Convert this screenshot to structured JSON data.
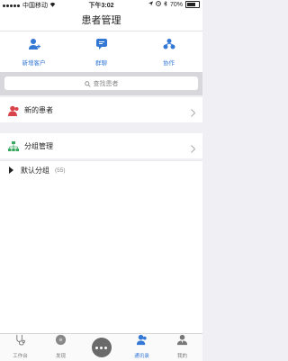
{
  "status_bar": {
    "carrier": "中国移动",
    "time": "下午3:02",
    "battery": "70%"
  },
  "navbar": {
    "title": "患者管理"
  },
  "actions": [
    {
      "label": "新增客户",
      "icon": "add-user-icon"
    },
    {
      "label": "群聊",
      "icon": "chat-icon"
    },
    {
      "label": "协作",
      "icon": "collaboration-icon"
    }
  ],
  "search": {
    "placeholder": "查找患者"
  },
  "rows": {
    "new_patients": "新的患者",
    "group_management": "分组管理"
  },
  "group": {
    "name": "默认分组",
    "count": "(55)"
  },
  "tabs": [
    {
      "label": "工作台",
      "icon": "stethoscope-icon"
    },
    {
      "label": "发现",
      "icon": "discover-icon"
    },
    {
      "label": "",
      "icon": "center-chat-icon"
    },
    {
      "label": "通讯录",
      "icon": "contacts-icon"
    },
    {
      "label": "我的",
      "icon": "profile-icon"
    }
  ],
  "colors": {
    "accent": "#3478d6",
    "red_icon": "#d9434b",
    "green_icon": "#3aa860"
  }
}
